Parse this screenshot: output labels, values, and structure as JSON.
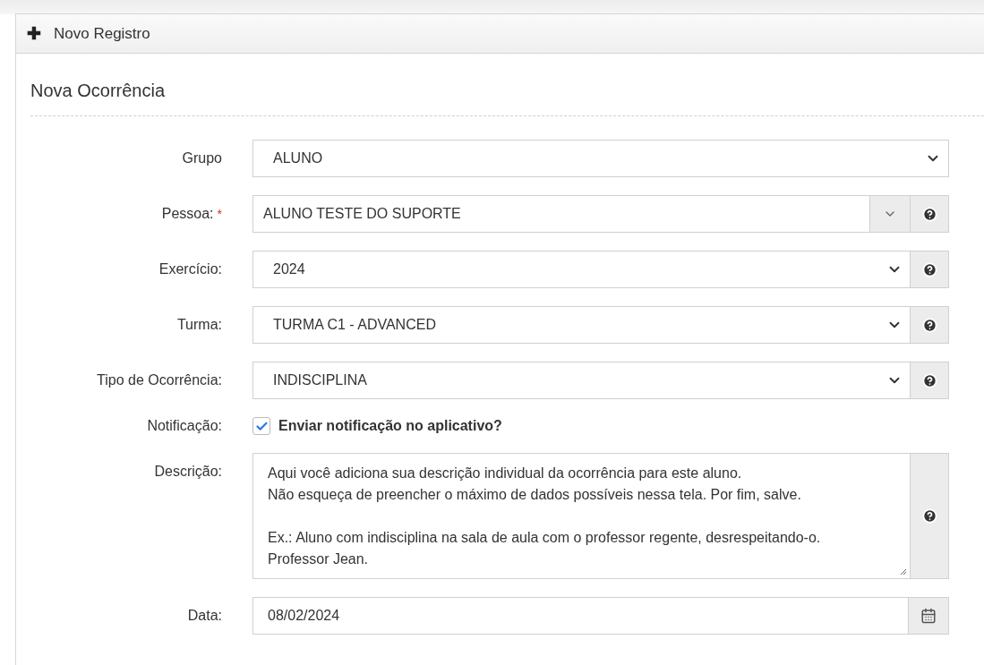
{
  "panel": {
    "header_icon": "✚",
    "header_title": "Novo Registro",
    "section_title": "Nova Ocorrência"
  },
  "fields": [
    {
      "kind": "select",
      "label": "Grupo",
      "value": "ALUNO"
    },
    {
      "kind": "combo",
      "label": "Pessoa:",
      "required_mark": "*",
      "value": "ALUNO TESTE DO SUPORTE"
    },
    {
      "kind": "select_help",
      "label": "Exercício:",
      "value": "2024"
    },
    {
      "kind": "select_help",
      "label": "Turma:",
      "value": "TURMA C1 - ADVANCED"
    },
    {
      "kind": "select_help",
      "label": "Tipo de Ocorrência:",
      "value": "INDISCIPLINA"
    },
    {
      "kind": "checkbox",
      "label": "Notificação:",
      "value": "Enviar notificação no aplicativo?",
      "checked": true
    },
    {
      "kind": "textarea",
      "label": "Descrição:",
      "value": "Aqui você adiciona sua descrição individual da ocorrência para este aluno.\nNão esqueça de preencher o máximo de dados possíveis nessa tela. Por fim, salve.\n\nEx.: Aluno com indisciplina na sala de aula com o professor regente, desrespeitando-o.\nProfessor Jean."
    },
    {
      "kind": "date",
      "label": "Data:",
      "value": "08/02/2024"
    }
  ]
}
